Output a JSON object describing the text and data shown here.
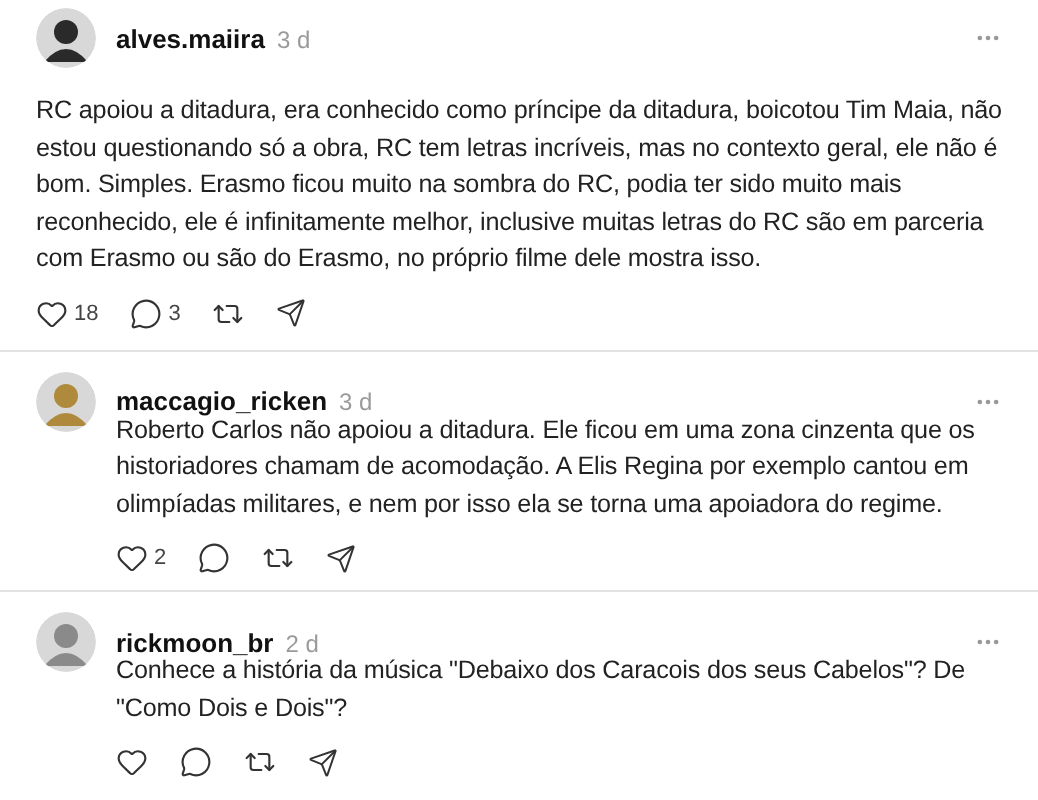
{
  "posts": [
    {
      "kind": "post",
      "username": "alves.maiira",
      "time": "3 d",
      "text": "RC apoiou a ditadura, era conhecido como príncipe da ditadura, boicotou Tim Maia, não estou questionando só a obra, RC tem letras incríveis, mas no contexto geral, ele não é bom. Simples. Erasmo ficou muito na sombra do RC, podia ter sido muito mais reconhecido, ele é infinitamente melhor, inclusive muitas letras do RC são em parceria com Erasmo ou são do Erasmo, no próprio filme dele mostra isso.",
      "likes": "18",
      "replies": "3"
    },
    {
      "kind": "reply",
      "username": "maccagio_ricken",
      "time": "3 d",
      "text": "Roberto Carlos não apoiou a ditadura. Ele ficou em uma zona cinzenta que os historiadores chamam de acomodação. A Elis Regina por exemplo cantou em olimpíadas militares, e nem por isso ela se torna uma apoiadora do regime.",
      "likes": "2"
    },
    {
      "kind": "reply",
      "username": "rickmoon_br",
      "time": "2 d",
      "text": "Conhece a história da música \"Debaixo dos Caracois dos seus Cabelos\"? De \"Como Dois e Dois\"?"
    }
  ]
}
